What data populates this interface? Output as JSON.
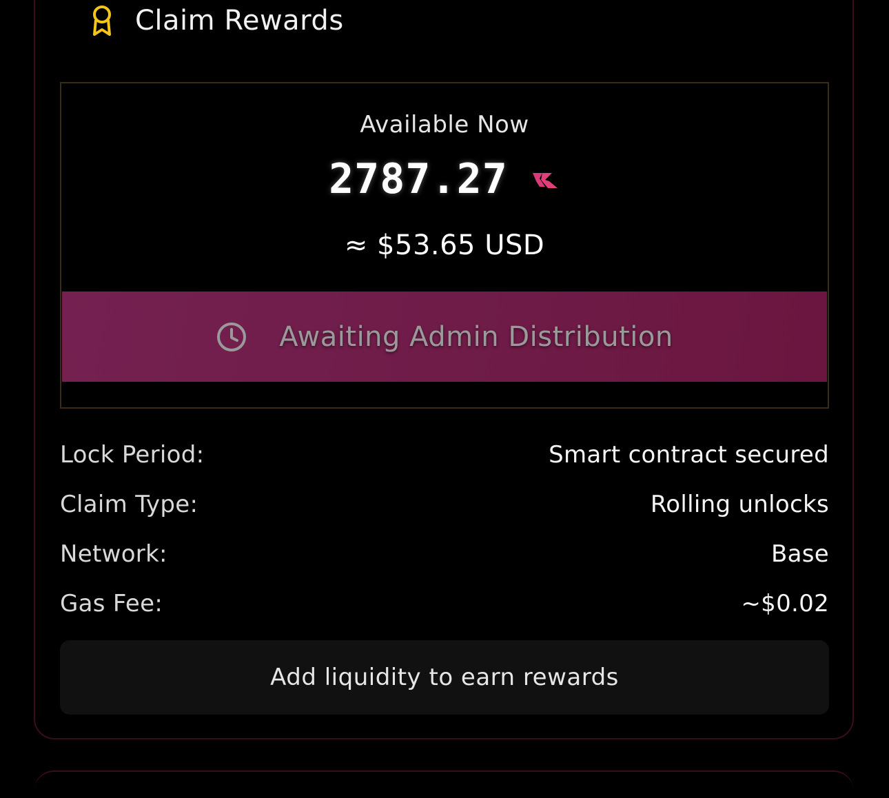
{
  "header": {
    "title": "Claim Rewards",
    "icon": "award-icon",
    "icon_color": "#f5c518"
  },
  "reward": {
    "available_label": "Available Now",
    "amount": "2787.27",
    "token_icon": "token-logo-icon",
    "token_color": "#e0407a",
    "usd_value": "≈ $53.65 USD"
  },
  "status_button": {
    "label": "Awaiting Admin Distribution",
    "icon": "clock-icon",
    "background": "#721e4c"
  },
  "details": [
    {
      "label": "Lock Period:",
      "value": "Smart contract secured"
    },
    {
      "label": "Claim Type:",
      "value": "Rolling unlocks"
    },
    {
      "label": "Network:",
      "value": "Base"
    },
    {
      "label": "Gas Fee:",
      "value": "~$0.02"
    }
  ],
  "liquidity_button": {
    "label": "Add liquidity to earn rewards"
  },
  "colors": {
    "background": "#000000",
    "card_border": "#3a0d1c",
    "box_border": "#3b2b17"
  }
}
